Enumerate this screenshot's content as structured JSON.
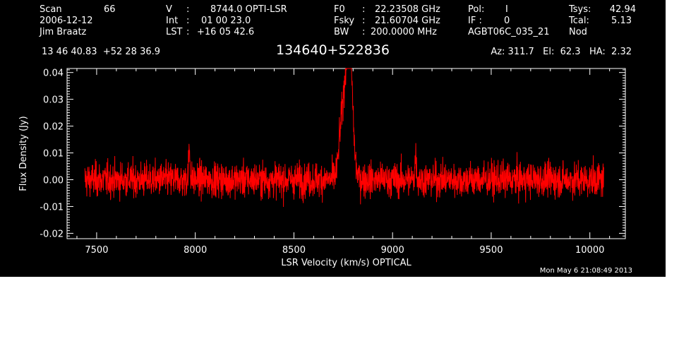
{
  "header": {
    "scan_label": "Scan",
    "scan_value": "66",
    "date": "2006-12-12",
    "observer": "Jim Braatz",
    "v_label": "V",
    "v_value": "8744.0 OPTI-LSR",
    "int_label": "Int",
    "int_value": "01 00 23.0",
    "lst_label": "LST",
    "lst_value": "+16 05 42.6",
    "f0_label": "F0",
    "f0_value": "22.23508 GHz",
    "fsky_label": "Fsky",
    "fsky_value": "21.60704 GHz",
    "bw_label": "BW",
    "bw_value": "200.0000 MHz",
    "pol_label": "Pol:",
    "pol_value": "I",
    "if_label": "IF :",
    "if_value": "0",
    "project": "AGBT06C_035_21",
    "tsys_label": "Tsys:",
    "tsys_value": "42.94",
    "tcal_label": "Tcal:",
    "tcal_value": "5.13",
    "mode": "Nod",
    "coords": "13 46 40.83  +52 28 36.9",
    "source": "134640+522836",
    "az_el_ha": "Az: 311.7   El:  62.3   HA:  2.32",
    "timestamp": "Mon May  6 21:08:49 2013"
  },
  "chart_data": {
    "type": "line",
    "xlabel": "LSR Velocity (km/s) OPTICAL",
    "ylabel": "Flux Density (Jy)",
    "xlim": [
      7350,
      10180
    ],
    "ylim": [
      -0.022,
      0.0415
    ],
    "x_ticks": [
      7500,
      8000,
      8500,
      9000,
      9500,
      10000
    ],
    "y_ticks": [
      -0.02,
      -0.01,
      0.0,
      0.01,
      0.02,
      0.03,
      0.04
    ],
    "y_tick_labels": [
      "-0.02",
      "-0.01",
      "0.00",
      "0.01",
      "0.02",
      "0.03",
      "0.04"
    ],
    "x_range": [
      7440,
      10070
    ],
    "n_points": 2600,
    "noise_rms": 0.0032,
    "features": [
      {
        "x": 7970,
        "peak": 0.011
      },
      {
        "x": 8738,
        "peak": 0.014
      },
      {
        "x": 8760,
        "peak": 0.022
      },
      {
        "x": 8779,
        "peak": 0.031
      },
      {
        "x": 8792,
        "peak": 0.018
      },
      {
        "x": 9117,
        "peak": 0.009
      }
    ],
    "series": [
      {
        "color": "#ff0000"
      }
    ],
    "grid": false
  },
  "colors": {
    "background": "#000000",
    "foreground": "#ffffff",
    "trace": "#ff0000"
  }
}
